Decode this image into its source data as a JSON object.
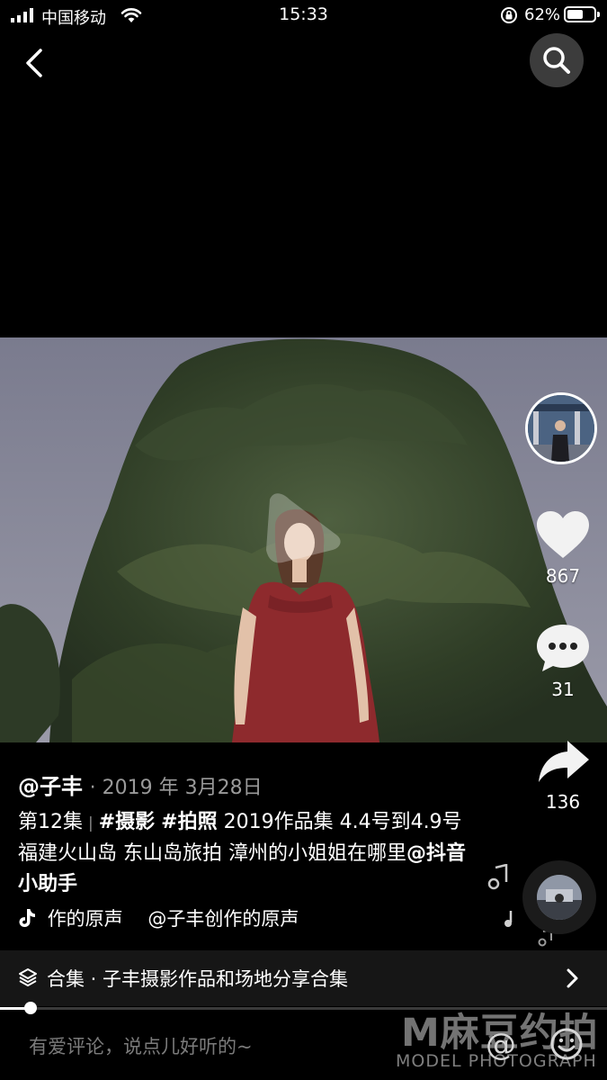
{
  "status_bar": {
    "carrier": "中国移动",
    "time": "15:33",
    "battery_percent": "62%",
    "battery_level": 0.62
  },
  "nav": {
    "back_icon": "chevron-left-icon",
    "search_icon": "search-icon"
  },
  "actions": {
    "likes": "867",
    "comments": "31",
    "shares": "136"
  },
  "post": {
    "author": "@子丰",
    "date": "· 2019 年 3月28日",
    "episode": "第12集",
    "separator": "|",
    "tag_photography": "#摄影",
    "tag_photo": "#拍照",
    "caption_body": " 2019作品集 4.4号到4.9号福建火山岛 东山岛旅拍 漳州的小姐姐在哪里",
    "mention": "@抖音小助手"
  },
  "music": {
    "title": "作的原声　 @子丰创作的原声"
  },
  "collection": {
    "label": "合集 · 子丰摄影作品和场地分享合集"
  },
  "playback": {
    "progress": 0.05
  },
  "comment": {
    "placeholder": "有爱评论，说点儿好听的~",
    "mention_symbol": "@"
  },
  "watermark": {
    "brand": "M麻豆约拍",
    "subtitle": "MODEL PHOTOGRAPH"
  },
  "colors": {
    "background": "#000000",
    "collection_bar": "#161616",
    "dress": "#8e2a2d"
  }
}
